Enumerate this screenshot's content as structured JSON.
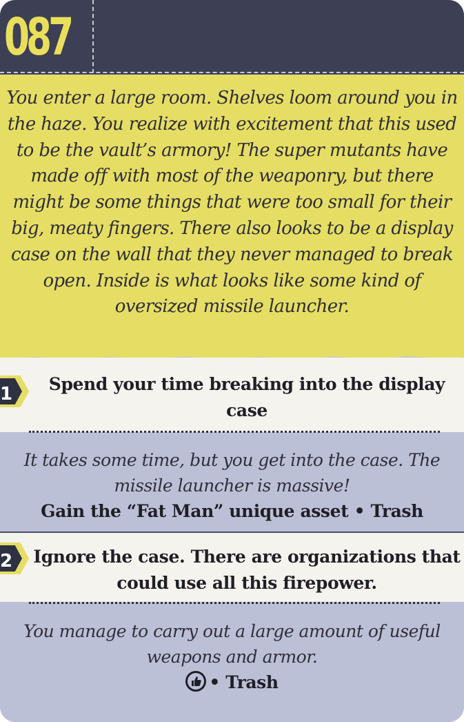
{
  "card": {
    "number": "087",
    "intro": "You enter a large room. Shelves loom around you in the haze. You realize with excitement that this used to be the vault’s armory! The super mutants have made off with most of the weaponry, but there might be some things that were too small for their big, meaty fingers. There also looks to be a display case on the wall that they never managed to break open. Inside is what looks like some kind of oversized missile launcher."
  },
  "choices": [
    {
      "number": "1",
      "label": "Spend your time breaking into the display case",
      "outcome_text": "It takes some time, but you get into the case. The missile launcher is massive!",
      "outcome_effect": "Gain the “Fat Man” unique asset • Trash"
    },
    {
      "number": "2",
      "label": "Ignore the case. There are organizations that could use all this firepower.",
      "outcome_text": "You manage to carry out a large amount of useful weapons and armor.",
      "outcome_effect_icon": "thumbs-up-reputation-icon",
      "outcome_effect": "• Trash"
    }
  ],
  "colors": {
    "header": "#3d4054",
    "number": "#e9df5c",
    "intro_bg": "#e6de64",
    "choice_bg": "#f4f3ee",
    "outcome_bg": "#bcc0d7"
  }
}
